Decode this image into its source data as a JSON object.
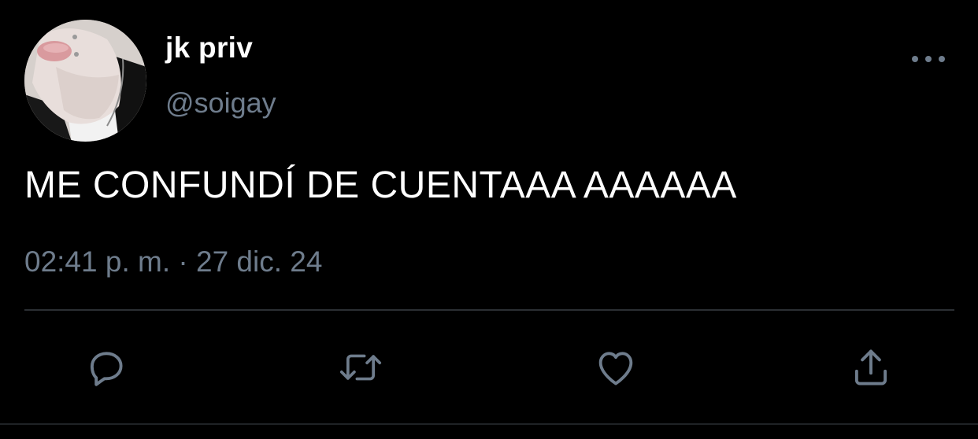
{
  "user": {
    "display_name": "jk priv",
    "handle": "@soigay"
  },
  "tweet": {
    "text": "ME CONFUNDÍ DE CUENTAAA AAAAAA",
    "timestamp": "02:41 p. m. · 27 dic. 24"
  },
  "actions": {
    "reply": "reply-icon",
    "retweet": "retweet-icon",
    "like": "heart-icon",
    "share": "share-icon"
  },
  "more_menu": "more-icon",
  "colors": {
    "background": "#000000",
    "text": "#ffffff",
    "secondary": "#6e7c8c",
    "divider": "#2b2f33"
  }
}
